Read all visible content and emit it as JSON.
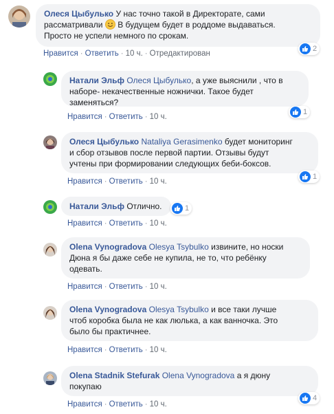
{
  "comments": [
    {
      "author": "Олеся Цыбулько",
      "text_line1": "У нас точно такой в Директорате, сами",
      "text_line2_before": "рассматривали",
      "emoji": "smile-emoji",
      "text_line2_after": "В будущем будет в роддоме выдаваться.",
      "text_line3": "Просто не успели немного по срокам.",
      "actions": {
        "like": "Нравится",
        "reply": "Ответить",
        "time": "10 ч.",
        "edited": "Отредактирован"
      },
      "reactions": "2"
    },
    {
      "author": "Натали Эльф",
      "mention": "Олеся Цыбулько",
      "text_line1_after": ", а уже выяснили , что в",
      "text_line2": "наборе- некачественные ножнички. Такое будет",
      "text_line3": "заменяться?",
      "actions": {
        "like": "Нравится",
        "reply": "Ответить",
        "time": "10 ч."
      },
      "reactions": "1"
    },
    {
      "author": "Олеся Цыбулько",
      "mention": "Nataliya Gerasimenko",
      "text_line1_after": "будет мониторинг",
      "text_line2": "и сбор отзывов после первой партии. Отзывы будут",
      "text_line3": "учтены при формировании следующих беби-боксов.",
      "actions": {
        "like": "Нравится",
        "reply": "Ответить",
        "time": "10 ч."
      },
      "reactions": "1"
    },
    {
      "author": "Натали Эльф",
      "text": "Отлично.",
      "actions": {
        "like": "Нравится",
        "reply": "Ответить",
        "time": "10 ч."
      },
      "reactions": "1"
    },
    {
      "author": "Olena Vynogradova",
      "mention": "Olesya Tsybulko",
      "text_line1_after": "извините, но носки",
      "text_line2": "Дюна я бы даже себе не купила, не то, что ребёнку",
      "text_line3": "одевать.",
      "actions": {
        "like": "Нравится",
        "reply": "Ответить",
        "time": "10 ч."
      }
    },
    {
      "author": "Olena Vynogradova",
      "mention": "Olesya Tsybulko",
      "text_line1_after": "и все таки лучше",
      "text_line2": "чтоб коробка была не как люлька, а как ванночка. Это",
      "text_line3": "было бы практичнее.",
      "actions": {
        "like": "Нравится",
        "reply": "Ответить",
        "time": "10 ч."
      }
    },
    {
      "author": "Olena Stadnik Stefurak",
      "mention": "Olena Vynogradova",
      "text_line1_after": "а я дюну",
      "text_line2": "покупаю",
      "actions": {
        "like": "Нравится",
        "reply": "Ответить",
        "time": "10 ч."
      },
      "reactions": "4"
    }
  ],
  "colors": {
    "link": "#385898",
    "bubble": "#f2f3f5",
    "like": "#1877f2",
    "meta": "#606770"
  },
  "icons": {
    "like": "thumbs-up-icon",
    "smile": "smile-emoji"
  }
}
